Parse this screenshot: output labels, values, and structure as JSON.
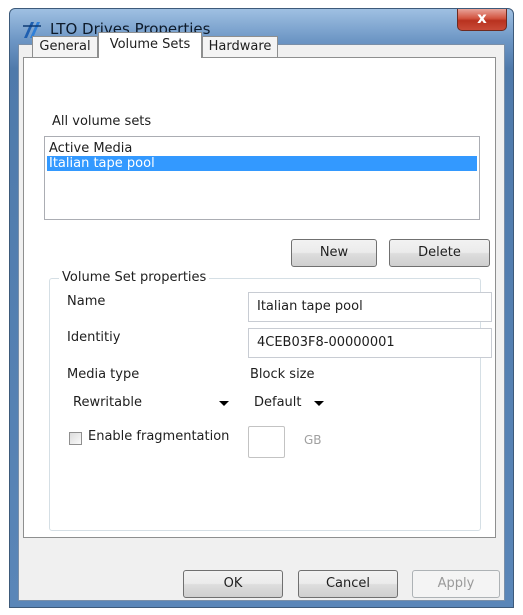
{
  "window": {
    "title": "LTO Drives Properties",
    "close_glyph": "x"
  },
  "tabs": [
    {
      "label": "General",
      "active": false
    },
    {
      "label": "Volume Sets",
      "active": true
    },
    {
      "label": "Hardware",
      "active": false
    }
  ],
  "volume_sets": {
    "list_label": "All volume sets",
    "items": [
      {
        "label": "Active Media",
        "selected": false
      },
      {
        "label": "Italian tape pool",
        "selected": true
      }
    ],
    "new_label": "New",
    "delete_label": "Delete"
  },
  "properties": {
    "group_title": "Volume Set properties",
    "name_label": "Name",
    "name_value": "Italian tape pool",
    "identity_label": "Identitiy",
    "identity_value": "4CEB03F8-00000001",
    "media_type_label": "Media type",
    "media_type_value": "Rewritable",
    "block_size_label": "Block size",
    "block_size_value": "Default",
    "fragmentation_label": "Enable fragmentation",
    "fragmentation_checked": false,
    "fragment_size_value": "",
    "fragment_unit": "GB"
  },
  "footer": {
    "ok_label": "OK",
    "cancel_label": "Cancel",
    "apply_label": "Apply"
  },
  "colors": {
    "selection": "#3399ff",
    "close_button": "#c94a37",
    "title_bar": "#6f98c6"
  },
  "icons": {
    "app": "lto-drive-app-icon",
    "close": "close-icon",
    "dropdown": "chevron-down-icon"
  }
}
